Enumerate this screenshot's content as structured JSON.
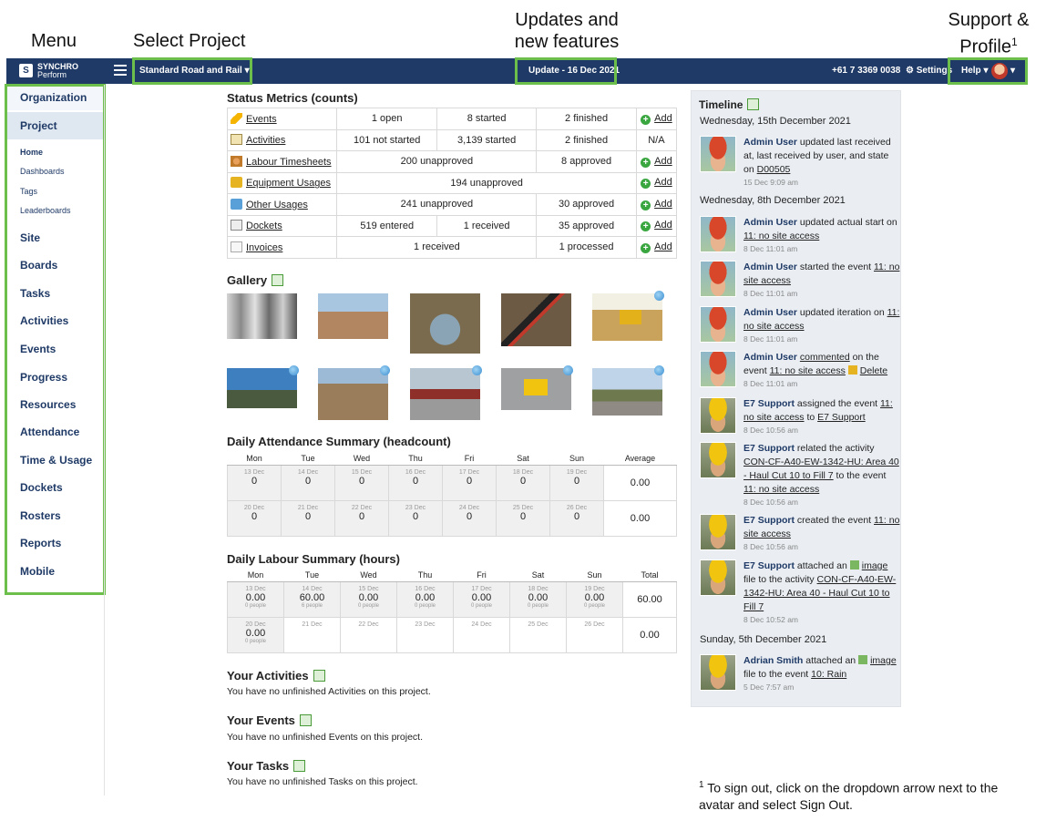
{
  "callouts": {
    "menu": "Menu",
    "select_project": "Select Project",
    "updates_line1": "Updates and",
    "updates_line2": "new features",
    "support_line1": "Support &",
    "support_line2": "Profile",
    "support_sup": "1"
  },
  "topbar": {
    "logo_line1": "SYNCHRO",
    "logo_line2": "Perform",
    "project": "Standard Road and Rail",
    "update": "Update - 16 Dec 2021",
    "phone": "+61 7 3369 0038",
    "settings": "Settings",
    "help": "Help"
  },
  "sidebar": {
    "organization": "Organization",
    "project": "Project",
    "sub": [
      "Home",
      "Dashboards",
      "Tags",
      "Leaderboards"
    ],
    "items": [
      "Site",
      "Boards",
      "Tasks",
      "Activities",
      "Events",
      "Progress",
      "Resources",
      "Attendance",
      "Time & Usage",
      "Dockets",
      "Rosters",
      "Reports",
      "Mobile"
    ]
  },
  "status": {
    "title": "Status Metrics (counts)",
    "add_label": "Add",
    "na": "N/A",
    "rows": [
      {
        "label": "Events",
        "c1": "1 open",
        "c2": "8 started",
        "c3": "2 finished"
      },
      {
        "label": "Activities",
        "c1": "101 not started",
        "c2": "3,139 started",
        "c3": "2 finished"
      },
      {
        "label": "Labour Timesheets",
        "c1": "200 unapproved",
        "c2": "8 approved"
      },
      {
        "label": "Equipment Usages",
        "c1": "194 unapproved"
      },
      {
        "label": "Other Usages",
        "c1": "241 unapproved",
        "c2": "30 approved"
      },
      {
        "label": "Dockets",
        "c1": "519 entered",
        "c2": "1 received",
        "c3": "35 approved"
      },
      {
        "label": "Invoices",
        "c1": "1 received",
        "c2": "1 processed"
      }
    ]
  },
  "gallery": {
    "title": "Gallery"
  },
  "attendance": {
    "title": "Daily Attendance Summary (headcount)",
    "days": [
      "Mon",
      "Tue",
      "Wed",
      "Thu",
      "Fri",
      "Sat",
      "Sun"
    ],
    "average_label": "Average",
    "week1_dates": [
      "13 Dec",
      "14 Dec",
      "15 Dec",
      "16 Dec",
      "17 Dec",
      "18 Dec",
      "19 Dec"
    ],
    "week1_values": [
      "0",
      "0",
      "0",
      "0",
      "0",
      "0",
      "0"
    ],
    "week1_avg": "0.00",
    "week2_dates": [
      "20 Dec",
      "21 Dec",
      "22 Dec",
      "23 Dec",
      "24 Dec",
      "25 Dec",
      "26 Dec"
    ],
    "week2_values": [
      "0",
      "0",
      "0",
      "0",
      "0",
      "0",
      "0"
    ],
    "week2_avg": "0.00"
  },
  "labour": {
    "title": "Daily Labour Summary (hours)",
    "days": [
      "Mon",
      "Tue",
      "Wed",
      "Thu",
      "Fri",
      "Sat",
      "Sun"
    ],
    "total_label": "Total",
    "week1_dates": [
      "13 Dec",
      "14 Dec",
      "15 Dec",
      "16 Dec",
      "17 Dec",
      "18 Dec",
      "19 Dec"
    ],
    "week1_values": [
      "0.00",
      "60.00",
      "0.00",
      "0.00",
      "0.00",
      "0.00",
      "0.00"
    ],
    "week1_people": [
      "0 people",
      "6 people",
      "0 people",
      "0 people",
      "0 people",
      "0 people",
      "0 people"
    ],
    "week1_total": "60.00",
    "week2_dates": [
      "20 Dec",
      "21 Dec",
      "22 Dec",
      "23 Dec",
      "24 Dec",
      "25 Dec",
      "26 Dec"
    ],
    "week2_mon_value": "0.00",
    "week2_mon_people": "0 people",
    "week2_total": "0.00"
  },
  "your_activities": {
    "title": "Your Activities",
    "text": "You have no unfinished Activities on this project."
  },
  "your_events": {
    "title": "Your Events",
    "text": "You have no unfinished Events on this project."
  },
  "your_tasks": {
    "title": "Your Tasks",
    "text": "You have no unfinished Tasks on this project."
  },
  "timeline": {
    "title": "Timeline",
    "dates": [
      "Wednesday, 15th December 2021",
      "Wednesday, 8th December 2021",
      "Sunday, 5th December 2021"
    ],
    "entries": [
      {
        "user": "Admin User",
        "text": " updated last received at, last received by user, and state on ",
        "link": "D00505",
        "time": "15 Dec 9:09 am"
      },
      {
        "user": "Admin User",
        "text": " updated actual start on ",
        "link": "11: no site access",
        "time": "8 Dec 11:01 am"
      },
      {
        "user": "Admin User",
        "text": " started the event ",
        "link": "11: no site access",
        "time": "8 Dec 11:01 am"
      },
      {
        "user": "Admin User",
        "text": " updated iteration on ",
        "link": "11: no site access",
        "time": "8 Dec 11:01 am"
      },
      {
        "user": "Admin User",
        "text1": " ",
        "link1": "commented",
        "text2": " on the event ",
        "link": "11: no site access",
        "extra": "Delete",
        "time": "8 Dec 11:01 am"
      },
      {
        "user": "E7 Support",
        "text": " assigned the event ",
        "link": "11: no site access",
        "text2": " to ",
        "link2": "E7 Support",
        "time": "8 Dec 10:56 am"
      },
      {
        "user": "E7 Support",
        "text": " related the activity ",
        "link": "CON-CF-A40-EW-1342-HU: Area 40 - Haul Cut 10 to Fill 7",
        "text2": " to the event ",
        "link2": "11: no site access",
        "time": "8 Dec 10:56 am"
      },
      {
        "user": "E7 Support",
        "text": " created the event ",
        "link": "11: no site access",
        "time": "8 Dec 10:56 am"
      },
      {
        "user": "E7 Support",
        "text": " attached an ",
        "link": "image",
        "text2": " file to the activity ",
        "link2": "CON-CF-A40-EW-1342-HU: Area 40 - Haul Cut 10 to Fill 7",
        "time": "8 Dec 10:52 am"
      },
      {
        "user": "Adrian Smith",
        "text": " attached an ",
        "link": "image",
        "text2": " file to the event ",
        "link2": "10: Rain",
        "time": "5 Dec 7:57 am"
      }
    ]
  },
  "footnote": {
    "sup": "1",
    "text": " To sign out, click on the dropdown arrow next to the avatar and select Sign Out."
  },
  "colors": {
    "topbar": "#1f3a66",
    "callout_box": "#6cbf4a",
    "link_blue": "#1f3a66",
    "timeline_bg": "#eaeef3"
  }
}
